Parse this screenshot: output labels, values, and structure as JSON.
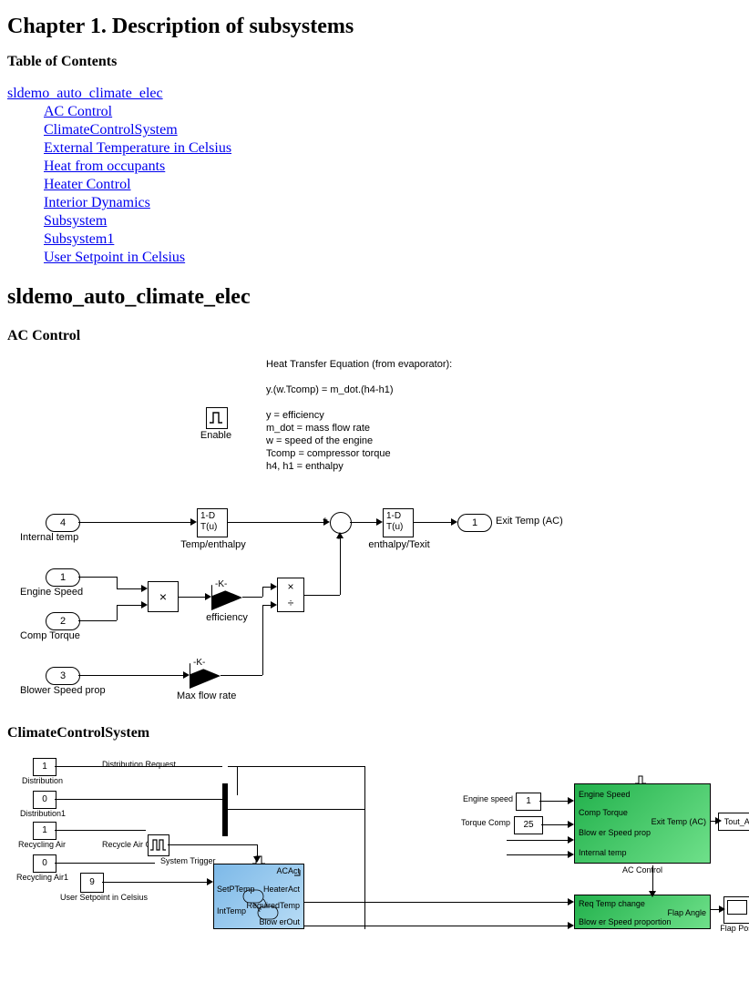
{
  "chapter_title": "Chapter 1. Description of subsystems",
  "toc_heading": "Table of Contents",
  "toc_root": "sldemo_auto_climate_elec",
  "toc_items": [
    "AC Control",
    "ClimateControlSystem",
    "External Temperature in Celsius",
    "Heat from occupants",
    "Heater Control",
    "Interior Dynamics",
    "Subsystem",
    "Subsystem1",
    "User Setpoint in Celsius"
  ],
  "section_title": "sldemo_auto_climate_elec",
  "subsection_ac": "AC Control",
  "subsection_ccs": "ClimateControlSystem",
  "d1": {
    "eq_heading": "Heat Transfer Equation (from evaporator):",
    "eq_main": "y.(w.Tcomp) = m_dot.(h4-h1)",
    "eq_l1": "y = efficiency",
    "eq_l2": "m_dot = mass flow rate",
    "eq_l3": "w = speed of the engine",
    "eq_l4": "Tcomp = compressor torque",
    "eq_l5": "h4, h1 = enthalpy",
    "enable_label": "Enable",
    "port4": "4",
    "port4_label": "Internal temp",
    "port1": "1",
    "port1_label": "Engine Speed",
    "port2": "2",
    "port2_label": "Comp Torque",
    "port3": "3",
    "port3_label": "Blower Speed prop",
    "out1": "1",
    "out1_label": "Exit Temp (AC)",
    "lut1_l1": "1-D",
    "lut1_l2": "T(u)",
    "lut1_label": "Temp/enthalpy",
    "lut2_l1": "1-D",
    "lut2_l2": "T(u)",
    "lut2_label": "enthalpy/Texit",
    "gain1": "-K-",
    "gain1_label": "efficiency",
    "gain2": "-K-",
    "gain2_label": "Max flow rate",
    "prod1": "×",
    "prod2_top": "×",
    "prod2_bot": "÷",
    "sum_plus": "+",
    "sum_minus": "-"
  },
  "d2": {
    "const_dist": "1",
    "lbl_dist": "Distribution",
    "const_dist1": "0",
    "lbl_dist1": "Distribution1",
    "const_recy": "1",
    "lbl_recy": "Recycling Air",
    "const_recy1": "0",
    "lbl_recy1": "Recycling Air1",
    "const_user": "9",
    "lbl_user": "User Setpoint in Celsius",
    "const_eng": "1",
    "lbl_eng": "Engine speed",
    "const_tq": "25",
    "lbl_tq": "Torque Comp",
    "lbl_dist_req": "Distribution Request",
    "lbl_recy_on": "Recycle Air On",
    "lbl_sys_trig": "System Trigger",
    "blue_in_set": "SetPTemp",
    "blue_in_int": "IntTemp",
    "blue_top": "ACAct",
    "blue_out_heater": "HeaterAct",
    "blue_out_req": "RequiredTemp",
    "blue_out_blow": "Blow erOut",
    "g1_in1": "Engine Speed",
    "g1_in2": "Comp Torque",
    "g1_in3": "Blow er Speed prop",
    "g1_in4": "Internal temp",
    "g1_out": "Exit Temp (AC)",
    "g1_title": "AC Control",
    "g2_in1": "Req Temp change",
    "g2_in2": "Blow er Speed proportion",
    "g2_out": "Flap Angle",
    "goto_tout": "Tout_AC",
    "lbl_flappos": "Flap Pos"
  }
}
